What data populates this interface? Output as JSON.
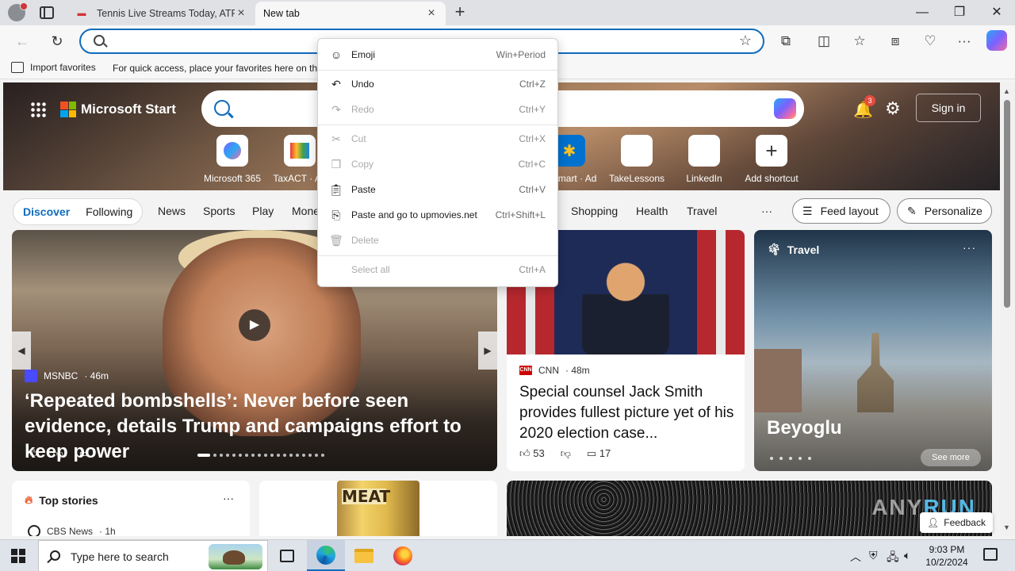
{
  "browser": {
    "tabs": [
      {
        "title": "Tennis Live Streams Today, ATP & WTA Tennis",
        "active": false
      },
      {
        "title": "New tab",
        "active": true
      }
    ],
    "new_tab_label": "+",
    "window_controls": {
      "minimize": "—",
      "restore": "❐",
      "close": "✕"
    },
    "address": {
      "value": "",
      "placeholder": ""
    },
    "favorites_bar": {
      "import_label": "Import favorites",
      "hint": "For quick access, place your favorites here on the favorites bar."
    }
  },
  "context_menu": {
    "items": [
      {
        "label": "Emoji",
        "shortcut": "Win+Period",
        "icon": "emoji-icon",
        "enabled": true
      },
      {
        "label": "Undo",
        "shortcut": "Ctrl+Z",
        "icon": "undo-icon",
        "enabled": true
      },
      {
        "label": "Redo",
        "shortcut": "Ctrl+Y",
        "icon": "redo-icon",
        "enabled": false
      },
      {
        "label": "Cut",
        "shortcut": "Ctrl+X",
        "icon": "cut-icon",
        "enabled": false
      },
      {
        "label": "Copy",
        "shortcut": "Ctrl+C",
        "icon": "copy-icon",
        "enabled": false
      },
      {
        "label": "Paste",
        "shortcut": "Ctrl+V",
        "icon": "paste-icon",
        "enabled": true
      },
      {
        "label": "Paste and go to upmovies.net",
        "shortcut": "Ctrl+Shift+L",
        "icon": "paste-go-icon",
        "enabled": true
      },
      {
        "label": "Delete",
        "shortcut": "",
        "icon": "delete-icon",
        "enabled": false
      },
      {
        "label": "Select all",
        "shortcut": "Ctrl+A",
        "icon": "",
        "enabled": false
      }
    ]
  },
  "msn": {
    "brand": "Microsoft Start",
    "notifications_count": "3",
    "signin_label": "Sign in",
    "shortcuts": [
      {
        "label": "Microsoft 365"
      },
      {
        "label": "TaxACT · Ad"
      },
      {
        "label": "Walmart · Ad"
      },
      {
        "label": "TakeLessons"
      },
      {
        "label": "LinkedIn"
      },
      {
        "label": "Add shortcut"
      }
    ],
    "nav": {
      "discover": "Discover",
      "following": "Following",
      "links": [
        "News",
        "Sports",
        "Play",
        "Money",
        "Shopping",
        "Health",
        "Travel"
      ],
      "more": "···",
      "feed_layout": "Feed layout",
      "personalize": "Personalize"
    },
    "cards": {
      "big": {
        "source": "MSNBC",
        "age": "· 46m",
        "headline": "‘Repeated bombshells’: Never before seen evidence, details Trump and campaigns effort to keep power"
      },
      "news": {
        "source": "CNN",
        "age": "· 48m",
        "headline": "Special counsel Jack Smith provides fullest picture yet of his 2020 election case...",
        "likes": "53",
        "comments": "17"
      },
      "travel": {
        "tag": "Travel",
        "headline": "Beyoglu",
        "see_more": "See more"
      },
      "top_stories": {
        "title": "Top stories",
        "source": "CBS News",
        "age": "· 1h"
      },
      "ad": {
        "can_label": "MEAT"
      },
      "watermark": {
        "part1": "ANY",
        "part2": "RUN"
      }
    },
    "feedback_label": "Feedback"
  },
  "taskbar": {
    "search_placeholder": "Type here to search",
    "time": "9:03 PM",
    "date": "10/2/2024"
  }
}
